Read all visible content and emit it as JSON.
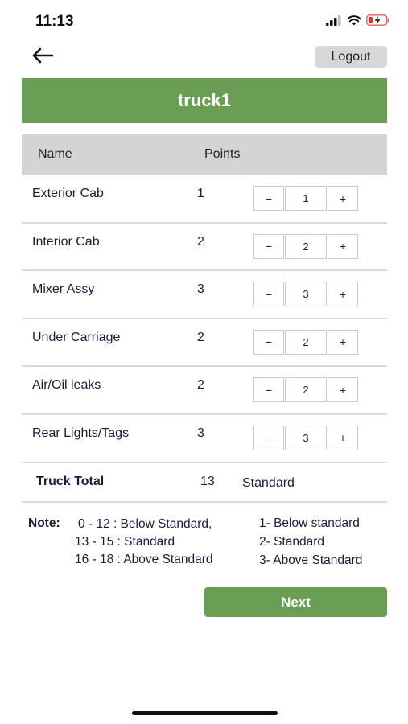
{
  "status_bar": {
    "time": "11:13"
  },
  "topbar": {
    "logout_label": "Logout"
  },
  "title": "truck1",
  "table": {
    "headers": {
      "name": "Name",
      "points": "Points"
    },
    "rows": [
      {
        "name": "Exterior Cab",
        "points": "1",
        "value": "1"
      },
      {
        "name": "Interior Cab",
        "points": "2",
        "value": "2"
      },
      {
        "name": "Mixer Assy",
        "points": "3",
        "value": "3"
      },
      {
        "name": "Under Carriage",
        "points": "2",
        "value": "2"
      },
      {
        "name": "Air/Oil leaks",
        "points": "2",
        "value": "2"
      },
      {
        "name": "Rear Lights/Tags",
        "points": "3",
        "value": "3"
      }
    ],
    "stepper": {
      "minus": "−",
      "plus": "+"
    }
  },
  "total": {
    "label": "Truck Total",
    "value": "13",
    "status": "Standard"
  },
  "note": {
    "label": "Note:",
    "left": [
      "0 - 12 : Below Standard,",
      "13 - 15 : Standard",
      "16 - 18 : Above Standard"
    ],
    "right": [
      "1- Below standard",
      "2- Standard",
      "3- Above Standard"
    ]
  },
  "next_label": "Next",
  "colors": {
    "accent_green": "#6a9e55",
    "header_gray": "#d4d4d4",
    "text": "#1c1c3a"
  }
}
